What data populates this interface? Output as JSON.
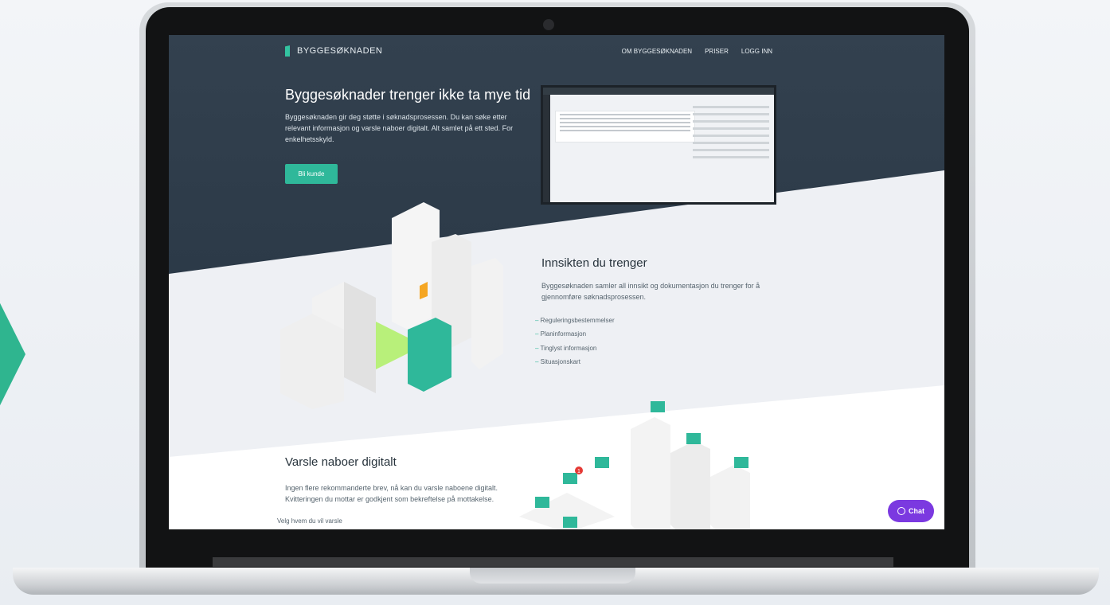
{
  "nav": {
    "logo_text": "BYGGESØKNADEN",
    "links": [
      "OM BYGGESØKNADEN",
      "PRISER",
      "LOGG INN"
    ]
  },
  "hero": {
    "title": "Byggesøknader trenger ikke ta mye tid",
    "text": "Byggesøknaden gir deg støtte i søknadsprosessen. Du kan søke etter relevant informasjon og varsle naboer digitalt. Alt samlet på ett sted. For enkelhetsskyld.",
    "cta_label": "Bli kunde"
  },
  "section_insight": {
    "title": "Innsikten du trenger",
    "text": "Byggesøknaden samler all innsikt og dokumentasjon du trenger for å gjennomføre søknadsprosessen.",
    "items": [
      "Reguleringsbestemmelser",
      "Planinformasjon",
      "Tinglyst informasjon",
      "Situasjonskart"
    ]
  },
  "section_neighbors": {
    "title": "Varsle naboer digitalt",
    "text": "Ingen flere rekommanderte brev, nå kan du varsle naboene digitalt. Kvitteringen du mottar er godkjent som bekreftelse på mottakelse.",
    "first_item": "Velg hvem du vil varsle"
  },
  "chat": {
    "label": "Chat"
  },
  "colors": {
    "hero_bg": "#2f3d4b",
    "accent": "#2fb89a",
    "chat": "#7b39e0"
  },
  "notification_badge": "1"
}
